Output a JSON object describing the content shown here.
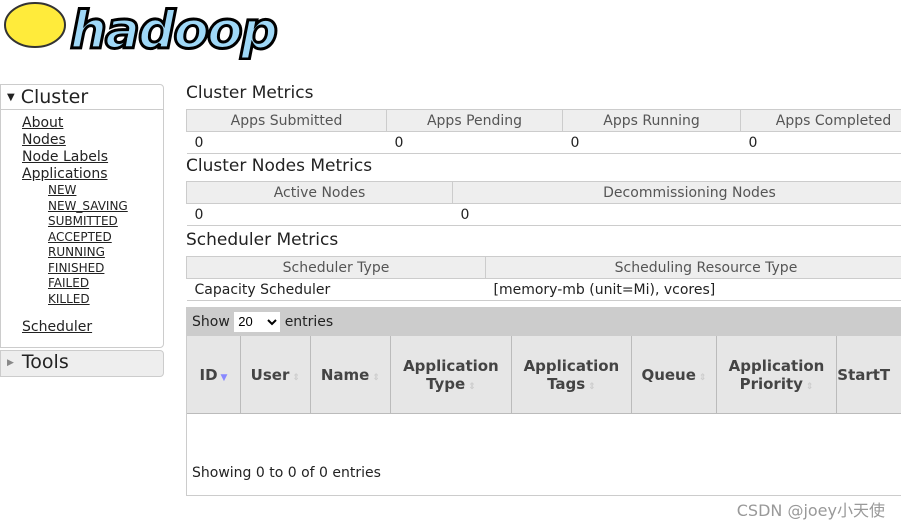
{
  "logo": {
    "text": "hadoop"
  },
  "nav": {
    "cluster_label": "Cluster",
    "links": [
      "About",
      "Nodes",
      "Node Labels",
      "Applications"
    ],
    "app_states": [
      "NEW",
      "NEW_SAVING",
      "SUBMITTED",
      "ACCEPTED",
      "RUNNING",
      "FINISHED",
      "FAILED",
      "KILLED"
    ],
    "scheduler": "Scheduler",
    "tools_label": "Tools"
  },
  "cluster_metrics": {
    "title": "Cluster Metrics",
    "headers": [
      "Apps Submitted",
      "Apps Pending",
      "Apps Running",
      "Apps Completed"
    ],
    "values": [
      "0",
      "0",
      "0",
      "0"
    ]
  },
  "nodes_metrics": {
    "title": "Cluster Nodes Metrics",
    "headers": [
      "Active Nodes",
      "Decommissioning Nodes"
    ],
    "values": [
      "0",
      "0"
    ]
  },
  "scheduler_metrics": {
    "title": "Scheduler Metrics",
    "headers": [
      "Scheduler Type",
      "Scheduling Resource Type"
    ],
    "values": [
      "Capacity Scheduler",
      "[memory-mb (unit=Mi), vcores]"
    ]
  },
  "apps": {
    "show": "Show",
    "entries": "entries",
    "page_size": "20",
    "columns": [
      "ID",
      "User",
      "Name",
      "Application Type",
      "Application Tags",
      "Queue",
      "Application Priority",
      "StartT"
    ],
    "info": "Showing 0 to 0 of 0 entries"
  },
  "watermark": "CSDN @joey小天使"
}
